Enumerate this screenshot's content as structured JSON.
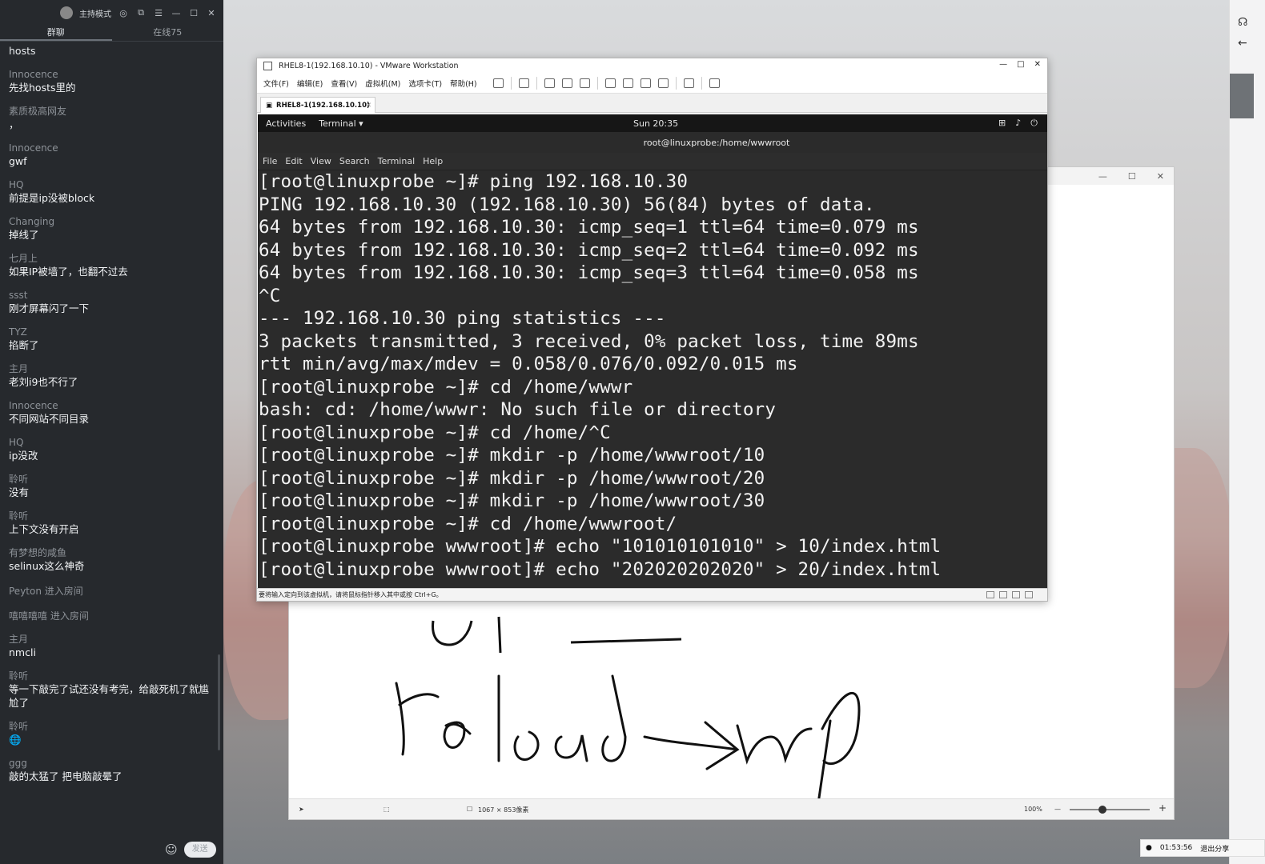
{
  "chat": {
    "mode_label": "主持模式",
    "tabs": [
      "群聊",
      "在线75"
    ],
    "top_partial": "hosts",
    "messages": [
      {
        "name": "Innocence",
        "text": "先找hosts里的"
      },
      {
        "name": "素质极高网友",
        "text": "，"
      },
      {
        "name": "Innocence",
        "text": "gwf"
      },
      {
        "name": "HQ",
        "text": "前提是ip没被block"
      },
      {
        "name": "Changing",
        "text": "掉线了"
      },
      {
        "name": "七月上",
        "text": "如果IP被墙了，也翻不过去"
      },
      {
        "name": "ssst",
        "text": "刚才屏幕闪了一下"
      },
      {
        "name": "TYZ",
        "text": "掐断了"
      },
      {
        "name": "主月",
        "text": "老刘i9也不行了"
      },
      {
        "name": "Innocence",
        "text": "不同网站不同目录"
      },
      {
        "name": "HQ",
        "text": "ip没改"
      },
      {
        "name": "聆听",
        "text": "没有"
      },
      {
        "name": "聆听",
        "text": "上下文没有开启"
      },
      {
        "name": "有梦想的咸鱼",
        "text": "selinux这么神奇"
      }
    ],
    "system_messages": [
      "Peyton 进入房间",
      "嘻嘻嘻嘻 进入房间"
    ],
    "messages2": [
      {
        "name": "主月",
        "text": "nmcli"
      },
      {
        "name": "聆听",
        "text": "等一下敲完了试还没有考完，给敲死机了就尴尬了"
      },
      {
        "name": "聆听",
        "text": "🌐"
      },
      {
        "name": "ggg",
        "text": "敲的太猛了 把电脑敲晕了"
      }
    ],
    "send_label": "发送"
  },
  "vmware": {
    "title": "RHEL8-1(192.168.10.10) - VMware Workstation",
    "menu": [
      "文件(F)",
      "编辑(E)",
      "查看(V)",
      "虚拟机(M)",
      "选项卡(T)",
      "帮助(H)"
    ],
    "tab_label": "RHEL8-1(192.168.10.10)",
    "status_text": "要将输入定向到该虚拟机，请将鼠标指针移入其中或按 Ctrl+G。"
  },
  "gnome": {
    "activities": "Activities",
    "app_menu": "Terminal ▾",
    "clock": "Sun 20:35"
  },
  "terminal": {
    "title": "root@linuxprobe:/home/wwwroot",
    "menu": [
      "File",
      "Edit",
      "View",
      "Search",
      "Terminal",
      "Help"
    ],
    "lines": [
      "[root@linuxprobe ~]# ping 192.168.10.30",
      "PING 192.168.10.30 (192.168.10.30) 56(84) bytes of data.",
      "64 bytes from 192.168.10.30: icmp_seq=1 ttl=64 time=0.079 ms",
      "64 bytes from 192.168.10.30: icmp_seq=2 ttl=64 time=0.092 ms",
      "64 bytes from 192.168.10.30: icmp_seq=3 ttl=64 time=0.058 ms",
      "^C",
      "--- 192.168.10.30 ping statistics ---",
      "3 packets transmitted, 3 received, 0% packet loss, time 89ms",
      "rtt min/avg/max/mdev = 0.058/0.076/0.092/0.015 ms",
      "[root@linuxprobe ~]# cd /home/wwwr",
      "bash: cd: /home/wwwr: No such file or directory",
      "[root@linuxprobe ~]# cd /home/^C",
      "[root@linuxprobe ~]# mkdir -p /home/wwwroot/10",
      "[root@linuxprobe ~]# mkdir -p /home/wwwroot/20",
      "[root@linuxprobe ~]# mkdir -p /home/wwwroot/30",
      "[root@linuxprobe ~]# cd /home/wwwroot/",
      "[root@linuxprobe wwwroot]# echo \"101010101010\" > 10/index.html",
      "[root@linuxprobe wwwroot]# echo \"202020202020\" > 20/index.html"
    ]
  },
  "paint": {
    "dimensions": "1067 × 853像素",
    "zoom": "100%"
  },
  "taskbar": {
    "time": "01:53:56",
    "share_label": "退出分享"
  }
}
